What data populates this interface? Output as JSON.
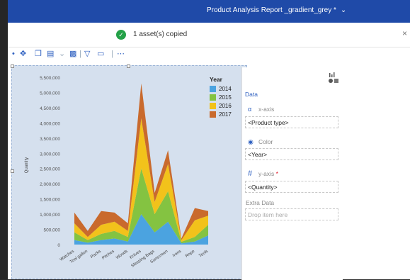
{
  "header": {
    "title": "Product Analysis Report _gradient_grey *"
  },
  "toast": {
    "message": "1 asset(s) copied"
  },
  "toolbar": {
    "items": [
      "pin-icon",
      "move-icon",
      "copy-icon",
      "paste-icon",
      "dropdown",
      "delete-icon",
      "filter-icon",
      "layout-icon",
      "more-icon"
    ]
  },
  "panel": {
    "section": "Data",
    "xaxis": {
      "label": "x-axis",
      "value": "<Product type>"
    },
    "color": {
      "label": "Color",
      "value": "<Year>"
    },
    "yaxis": {
      "label": "y-axis",
      "required": "*",
      "value": "<Quantity>"
    },
    "extra": {
      "label": "Extra Data",
      "placeholder": "Drop item here"
    }
  },
  "colors": {
    "accent": "#1f4aa8",
    "y2014": "#4ba3e0",
    "y2015": "#84c341",
    "y2016": "#f2c21b",
    "y2017": "#c96a2d",
    "plot_bg": "#d5e0ee"
  },
  "chart_data": {
    "type": "area",
    "stacked": true,
    "ylabel": "Quantity",
    "legend_title": "Year",
    "legend_position": "top-right",
    "ylim": [
      0,
      5500000
    ],
    "yticks": [
      "0",
      "500,000",
      "1,000,000",
      "1,500,000",
      "2,000,000",
      "2,500,000",
      "3,000,000",
      "3,500,000",
      "4,000,000",
      "4,500,000",
      "5,000,000",
      "5,500,000"
    ],
    "categories": [
      "Watches",
      "Tool gallon",
      "Packs",
      "Pitches",
      "Woods",
      "Knives",
      "Sleeping Bags",
      "Sunscreen",
      "Irons",
      "Rope",
      "Tools"
    ],
    "series": [
      {
        "name": "2014",
        "values": [
          150000,
          60000,
          150000,
          200000,
          100000,
          1000000,
          400000,
          750000,
          40000,
          100000,
          300000
        ]
      },
      {
        "name": "2015",
        "values": [
          250000,
          90000,
          200000,
          250000,
          150000,
          1500000,
          600000,
          1000000,
          50000,
          150000,
          350000
        ]
      },
      {
        "name": "2016",
        "values": [
          300000,
          100000,
          300000,
          300000,
          200000,
          1650000,
          400000,
          900000,
          60000,
          550000,
          300000
        ]
      },
      {
        "name": "2017",
        "values": [
          350000,
          200000,
          450000,
          300000,
          250000,
          1150000,
          300000,
          450000,
          50000,
          400000,
          150000
        ]
      }
    ]
  }
}
